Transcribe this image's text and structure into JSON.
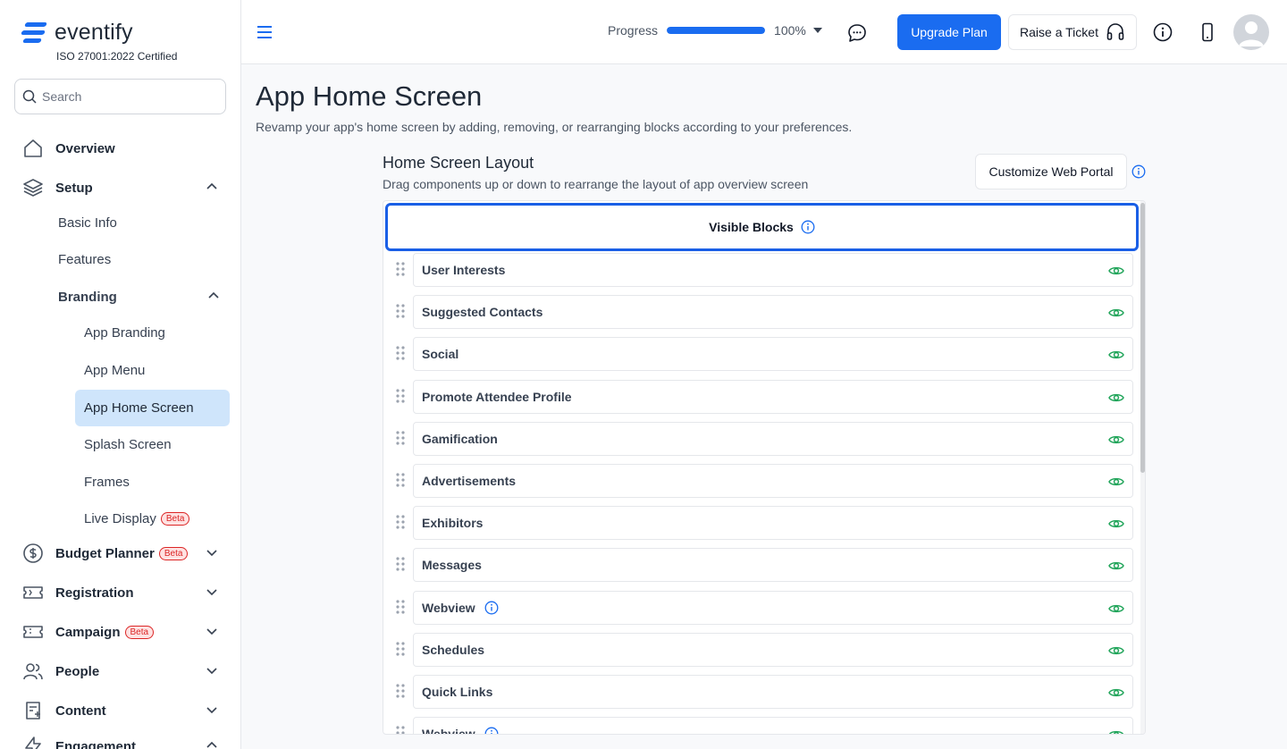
{
  "brand": {
    "name": "eventify",
    "certification": "ISO 27001:2022 Certified",
    "accent": "#1a6cf0"
  },
  "search": {
    "placeholder": "Search"
  },
  "sidebar": {
    "overview": "Overview",
    "setup": "Setup",
    "basic_info": "Basic Info",
    "features": "Features",
    "branding": "Branding",
    "app_branding": "App Branding",
    "app_menu": "App Menu",
    "app_home_screen": "App Home Screen",
    "splash_screen": "Splash Screen",
    "frames": "Frames",
    "live_display": "Live Display",
    "budget_planner": "Budget Planner",
    "registration": "Registration",
    "campaign": "Campaign",
    "people": "People",
    "content": "Content",
    "engagement": "Engagement",
    "beta_label": "Beta"
  },
  "topbar": {
    "progress_label": "Progress",
    "progress_value": "100%",
    "progress_fraction": 1.0,
    "upgrade_label": "Upgrade Plan",
    "ticket_label": "Raise a Ticket"
  },
  "main": {
    "title": "App Home Screen",
    "description": "Revamp your app's home screen by adding, removing, or rearranging blocks according to your preferences.",
    "layout_title": "Home Screen Layout",
    "layout_description": "Drag components up or down to rearrange the layout of app overview screen",
    "customize_label": "Customize Web Portal",
    "visible_blocks_label": "Visible Blocks",
    "blocks": [
      {
        "label": "User Interests",
        "info": false
      },
      {
        "label": "Suggested Contacts",
        "info": false
      },
      {
        "label": "Social",
        "info": false
      },
      {
        "label": "Promote Attendee Profile",
        "info": false
      },
      {
        "label": "Gamification",
        "info": false
      },
      {
        "label": "Advertisements",
        "info": false
      },
      {
        "label": "Exhibitors",
        "info": false
      },
      {
        "label": "Messages",
        "info": false
      },
      {
        "label": "Webview",
        "info": true
      },
      {
        "label": "Schedules",
        "info": false
      },
      {
        "label": "Quick Links",
        "info": false
      },
      {
        "label": "Webview",
        "info": true
      }
    ]
  }
}
